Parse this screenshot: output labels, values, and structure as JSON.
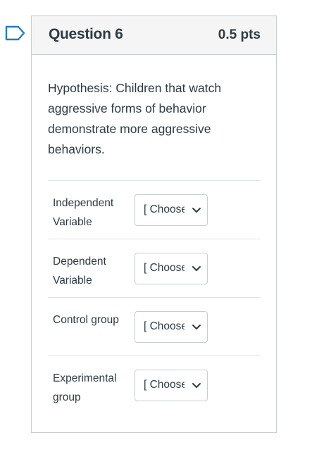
{
  "question": {
    "title": "Question 6",
    "points": "0.5 pts",
    "text": "Hypothesis: Children that watch aggressive forms of behavior demonstrate more aggressive behaviors."
  },
  "icons": {
    "flag": "bookmark-flag-icon",
    "dropdown": "chevron-down-icon"
  },
  "answers": [
    {
      "label": "Independent Variable",
      "selected": "[ Choose ]"
    },
    {
      "label": "Dependent Variable",
      "selected": "[ Choose ]"
    },
    {
      "label": "Control group",
      "selected": "[ Choose ]"
    },
    {
      "label": "Experimental group",
      "selected": "[ Choose ]"
    }
  ],
  "colors": {
    "flag": "#2b7abc",
    "text": "#2d3b45",
    "border": "#c7cdd1",
    "header_bg": "#f5f5f5"
  }
}
